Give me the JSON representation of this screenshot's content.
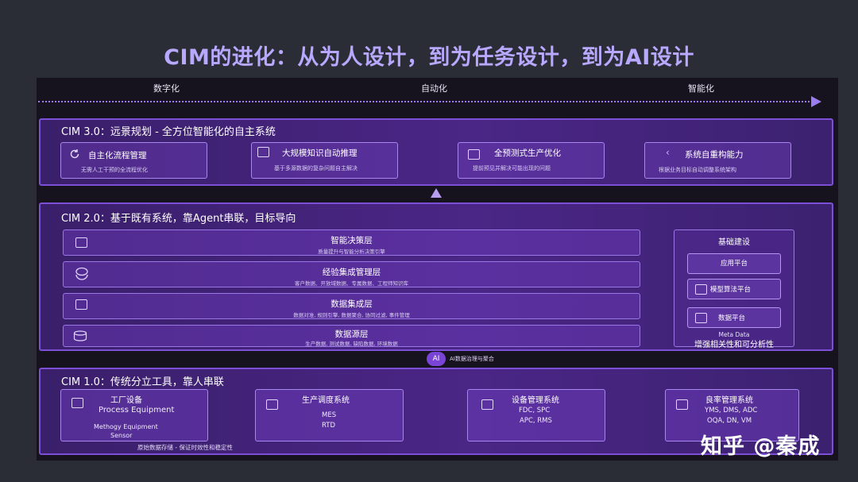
{
  "title": "CIM的进化：从为人设计，到为任务设计，到为AI设计",
  "stages": [
    "数字化",
    "自动化",
    "智能化"
  ],
  "cim3": {
    "title": "CIM 3.0：远景规划 - 全方位智能化的自主系统",
    "cards": [
      {
        "title": "自主化流程管理",
        "sub": "无需人工干预的全流程优化",
        "icon": "refresh-icon"
      },
      {
        "title": "大规模知识自动推理",
        "sub": "基于多源数据的复杂问题自主解决",
        "icon": "square-icon"
      },
      {
        "title": "全预测式生产优化",
        "sub": "提前预见并解决可能出现的问题",
        "icon": "square-icon"
      },
      {
        "title": "系统自重构能力",
        "sub": "根据业务目标自动调整系统架构",
        "icon": "bracket-icon"
      }
    ]
  },
  "cim2": {
    "title": "CIM 2.0：基于既有系统，靠Agent串联，目标导向",
    "rows": [
      {
        "title": "智能决策层",
        "sub": "质量提升与智能分析决策引擎",
        "icon": "square-icon"
      },
      {
        "title": "经验集成管理层",
        "sub": "客户数据、开放域数据、专属数据、工程师知识库",
        "icon": "layers-icon"
      },
      {
        "title": "数据集成层",
        "sub": "数据对准, 规则引擎, 数据聚合, 协同过滤, 事件管理",
        "icon": "square-icon"
      },
      {
        "title": "数据源层",
        "sub": "生产数据, 测试数据, 缺陷数据, 环境数据",
        "icon": "database-icon"
      }
    ],
    "side": {
      "title": "基础建设",
      "items": [
        "应用平台",
        "模型算法平台",
        "数据平台"
      ],
      "meta": "Meta Data",
      "footer": "增强相关性和可分析性"
    }
  },
  "ai": {
    "badge": "AI",
    "label": "AI数据治理与聚合"
  },
  "cim1": {
    "title": "CIM 1.0：传统分立工具，靠人串联",
    "boxes": [
      {
        "title": "工厂设备",
        "line1": "Process Equipment",
        "line2": "Methogy Equipment",
        "line3": "Sensor"
      },
      {
        "title": "生产调度系统",
        "line1": "MES",
        "line2": "RTD"
      },
      {
        "title": "设备管理系统",
        "line1": "FDC, SPC",
        "line2": "APC, RMS"
      },
      {
        "title": "良率管理系统",
        "line1": "YMS, DMS, ADC",
        "line2": "OQA, DN, VM"
      }
    ],
    "footer": "原始数据存储 - 保证时效性和稳定性"
  },
  "watermark": "知乎 @秦成",
  "colors": {
    "title": "#b8a8ff",
    "accent": "#7d4fd6",
    "panel": "#16131f",
    "background": "#2a2c36"
  }
}
